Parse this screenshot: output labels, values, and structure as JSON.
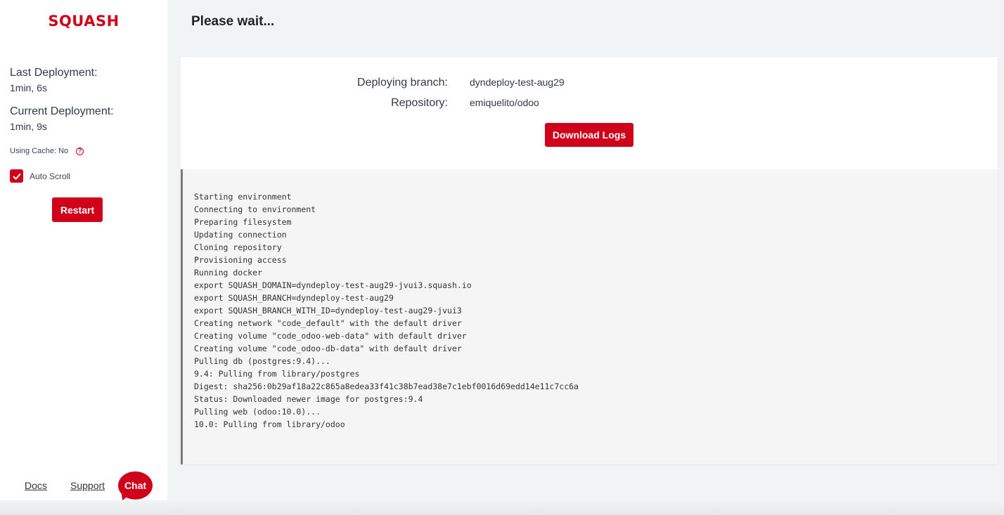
{
  "sidebar": {
    "logo": "SQUASH",
    "last_deployment_label": "Last Deployment:",
    "last_deployment_value": "1min, 6s",
    "current_deployment_label": "Current Deployment:",
    "current_deployment_value": "1min, 9s",
    "cache_label": "Using Cache: No",
    "autoscroll_label": "Auto Scroll",
    "autoscroll_checked": true,
    "restart_label": "Restart",
    "footer": {
      "docs": "Docs",
      "support": "Support",
      "chat": "Chat"
    }
  },
  "main": {
    "title": "Please wait...",
    "deploying_branch_label": "Deploying branch:",
    "deploying_branch_value": "dyndeploy-test-aug29",
    "repository_label": "Repository:",
    "repository_value": "emiquelito/odoo",
    "download_logs_label": "Download Logs",
    "logs": [
      "Starting environment",
      "Connecting to environment",
      "Preparing filesystem",
      "Updating connection",
      "Cloning repository",
      "Provisioning access",
      "Running docker",
      "export SQUASH_DOMAIN=dyndeploy-test-aug29-jvui3.squash.io",
      "export SQUASH_BRANCH=dyndeploy-test-aug29",
      "export SQUASH_BRANCH_WITH_ID=dyndeploy-test-aug29-jvui3",
      "Creating network \"code_default\" with the default driver",
      "Creating volume \"code_odoo-web-data\" with default driver",
      "Creating volume \"code_odoo-db-data\" with default driver",
      "Pulling db (postgres:9.4)...",
      "9.4: Pulling from library/postgres",
      "Digest: sha256:0b29af18a22c865a8edea33f41c38b7ead38e7c1ebf0016d69edd14e11c7cc6a",
      "Status: Downloaded newer image for postgres:9.4",
      "Pulling web (odoo:10.0)...",
      "10.0: Pulling from library/odoo"
    ]
  },
  "colors": {
    "brand": "#d0021b",
    "background": "#f2f3f5",
    "log_background": "#f5f5f5"
  }
}
